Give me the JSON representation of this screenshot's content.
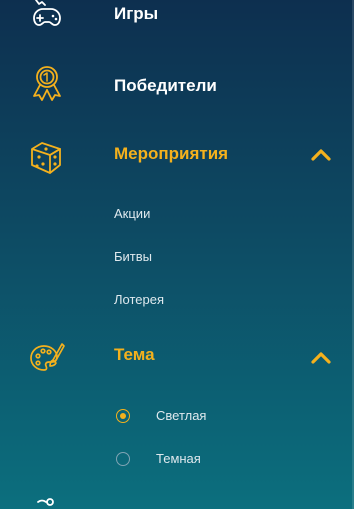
{
  "colors": {
    "accent": "#f4b11d",
    "text": "#ffffff",
    "subtext": "#dfe9ee",
    "bg_top": "#0d2f4f",
    "bg_bottom": "#0c6f7e"
  },
  "menu": {
    "items": [
      {
        "label": "Игры",
        "icon": "gamepad-icon",
        "active": false
      },
      {
        "label": "Победители",
        "icon": "medal-icon",
        "active": false
      },
      {
        "label": "Мероприятия",
        "icon": "dice-icon",
        "active": true,
        "expanded": true,
        "subitems": [
          "Акции",
          "Битвы",
          "Лотерея"
        ]
      },
      {
        "label": "Тема",
        "icon": "palette-icon",
        "active": true,
        "expanded": true,
        "options": [
          {
            "label": "Светлая",
            "selected": true
          },
          {
            "label": "Темная",
            "selected": false
          }
        ]
      }
    ],
    "partial_icon": "partial-next-icon"
  }
}
